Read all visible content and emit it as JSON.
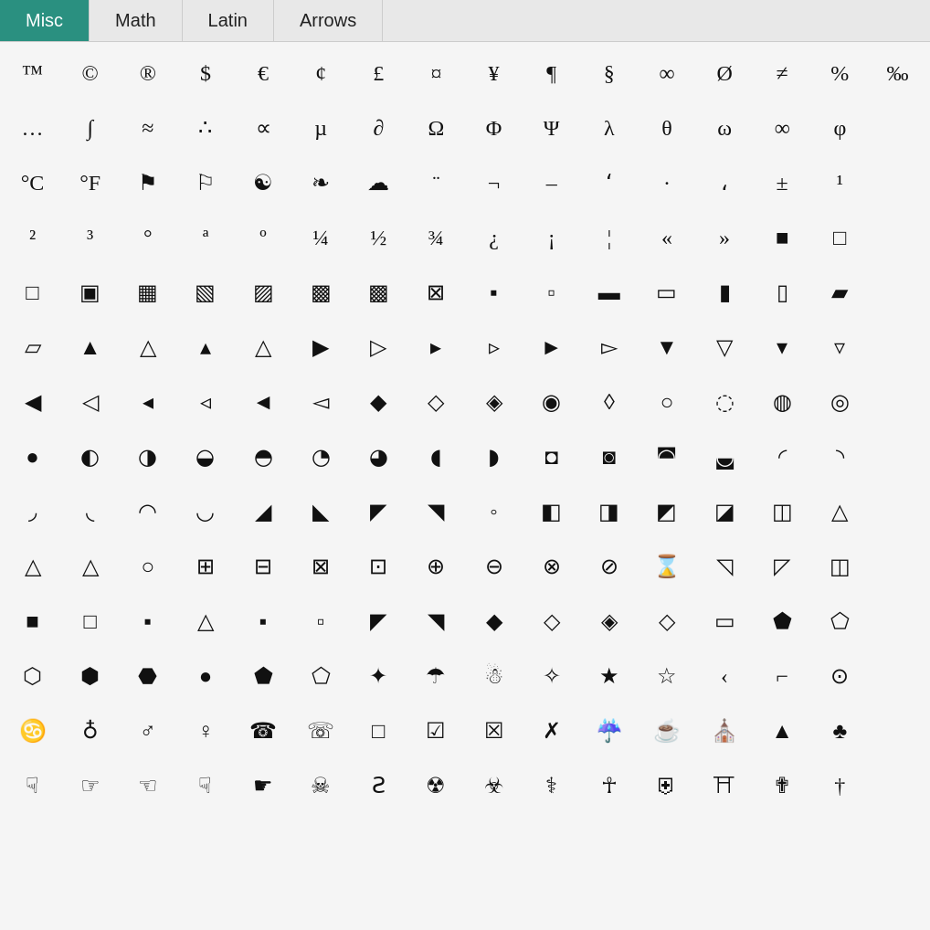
{
  "tabs": [
    {
      "label": "Misc",
      "active": true
    },
    {
      "label": "Math",
      "active": false
    },
    {
      "label": "Latin",
      "active": false
    },
    {
      "label": "Arrows",
      "active": false
    }
  ],
  "symbols": [
    "™",
    "©",
    "®",
    "$",
    "€",
    "¢",
    "£",
    "¤",
    "¥",
    "¶",
    "§",
    "∞",
    "Ø",
    "≠",
    "%",
    "‰",
    "…",
    "∫",
    "≈",
    "∴",
    "∝",
    "µ",
    "∂",
    "Ω",
    "Φ",
    "Ψ",
    "λ",
    "θ",
    "ω",
    "∞",
    "φ",
    "",
    "°C",
    "°F",
    "⚑",
    "⚐",
    "☯",
    "❧",
    "☁",
    "¨",
    "¬",
    "–",
    "ʻ",
    "·",
    "،",
    "±",
    "¹",
    "",
    "²",
    "³",
    "°",
    "ª",
    "º",
    "¼",
    "½",
    "¾",
    "¿",
    "¡",
    "¦",
    "«",
    "»",
    "■",
    "□",
    "",
    "□",
    "▣",
    "▦",
    "▧",
    "▨",
    "▩",
    "▩",
    "⊠",
    "▪",
    "▫",
    "▬",
    "▭",
    "▮",
    "▯",
    "▰",
    "",
    "▱",
    "▲",
    "△",
    "▴",
    "△",
    "▶",
    "▷",
    "▸",
    "▹",
    "►",
    "▻",
    "▼",
    "▽",
    "▾",
    "▿",
    "",
    "◀",
    "◁",
    "◂",
    "◃",
    "◄",
    "◅",
    "◆",
    "◇",
    "◈",
    "◉",
    "◊",
    "○",
    "◌",
    "◍",
    "◎",
    "",
    "●",
    "◐",
    "◑",
    "◒",
    "◓",
    "◔",
    "◕",
    "◖",
    "◗",
    "◘",
    "◙",
    "◚",
    "◛",
    "◜",
    "◝",
    "",
    "◞",
    "◟",
    "◠",
    "◡",
    "◢",
    "◣",
    "◤",
    "◥",
    "◦",
    "◧",
    "◨",
    "◩",
    "◪",
    "◫",
    "△",
    "",
    "△",
    "△",
    "○",
    "⊞",
    "⊟",
    "⊠",
    "⊡",
    "⊕",
    "⊖",
    "⊗",
    "⊘",
    "⌛",
    "◹",
    "◸",
    "◫",
    "",
    "■",
    "□",
    "▪",
    "△",
    "▪",
    "▫",
    "◤",
    "◥",
    "◆",
    "◇",
    "◈",
    "◇",
    "▭",
    "⬟",
    "⬠",
    "",
    "⬡",
    "⬢",
    "⬣",
    "●",
    "⬟",
    "⬠",
    "✦",
    "☂",
    "☃",
    "✧",
    "★",
    "☆",
    "‹",
    "⌐",
    "⊙",
    "",
    "♋",
    "♁",
    "♂",
    "♀",
    "☎",
    "☏",
    "□",
    "☑",
    "☒",
    "✗",
    "☔",
    "☕",
    "⛪",
    "▲",
    "♣",
    "",
    "☟",
    "☞",
    "☜",
    "☟",
    "☛",
    "☠",
    "Ƨ",
    "☢",
    "☣",
    "⚕",
    "☥",
    "⛨",
    "⛩",
    "✟",
    "†",
    ""
  ]
}
